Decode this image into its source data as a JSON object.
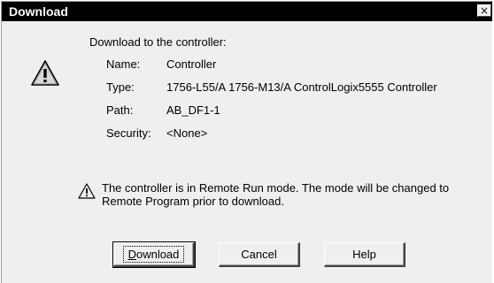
{
  "window": {
    "title": "Download",
    "close_glyph": "×"
  },
  "message": {
    "heading": "Download to the controller:",
    "fields": [
      {
        "label": "Name:",
        "value": "Controller"
      },
      {
        "label": "Type:",
        "value": "1756-L55/A 1756-M13/A ControlLogix5555 Controller"
      },
      {
        "label": "Path:",
        "value": "AB_DF1-1"
      },
      {
        "label": "Security:",
        "value": "<None>"
      }
    ],
    "warning_line1": "The controller is in Remote Run mode. The mode will be changed to",
    "warning_line2": "Remote Program prior to download."
  },
  "buttons": {
    "download_first": "D",
    "download_rest": "ownload",
    "cancel": "Cancel",
    "help": "Help"
  },
  "icons": {
    "dialog": "warning-icon",
    "note": "warning-small-icon"
  }
}
